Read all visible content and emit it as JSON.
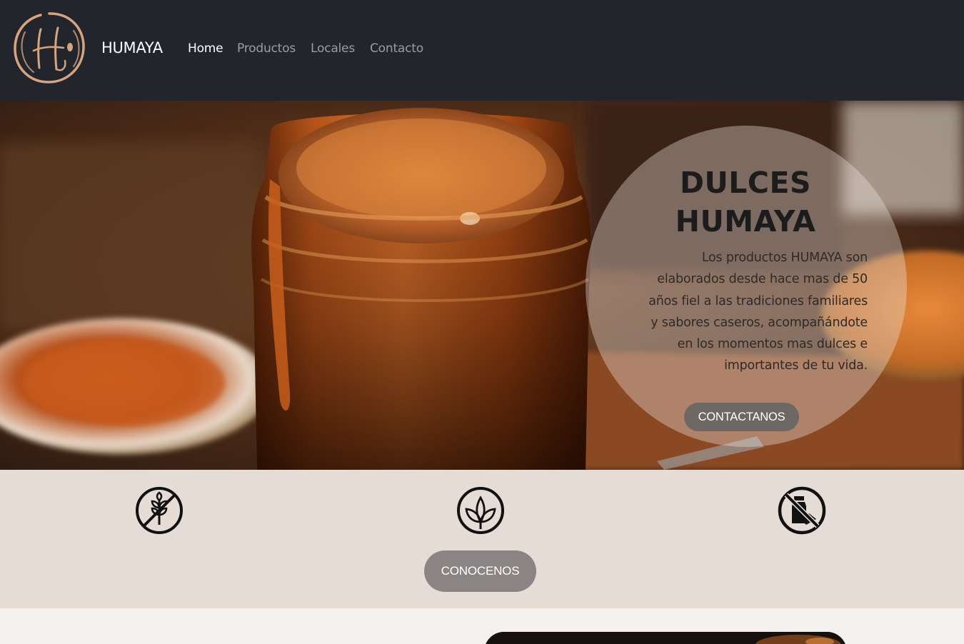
{
  "brand": {
    "name": "HUMAYA",
    "logo_letter": "H",
    "logo_icon": "humaya-logo-icon"
  },
  "nav": {
    "items": [
      {
        "label": "Home",
        "active": true
      },
      {
        "label": "Productos",
        "active": false
      },
      {
        "label": "Locales",
        "active": false
      },
      {
        "label": "Contacto",
        "active": false
      }
    ]
  },
  "hero": {
    "title_line1": "DULCES",
    "title_line2": "HUMAYA",
    "text_lines": [
      "Los productos HUMAYA son",
      "elaborados desde hace mas de 50",
      "años fiel a las tradiciones familiares",
      "y sabores caseros, acompañándote",
      "en los momentos mas dulces e",
      "importantes de tu vida."
    ],
    "cta_label": "CONTACTANOS"
  },
  "features": {
    "icons": [
      "gluten-free-icon",
      "plant-based-icon",
      "dairy-free-icon"
    ],
    "cta_label": "CONOCENOS"
  },
  "colors": {
    "navbar": "#22252b",
    "features_bg": "#e6dcd6",
    "logo_accent": "#d6a57f",
    "button_dark": "#6e6864",
    "button_grey": "#8a8584"
  }
}
